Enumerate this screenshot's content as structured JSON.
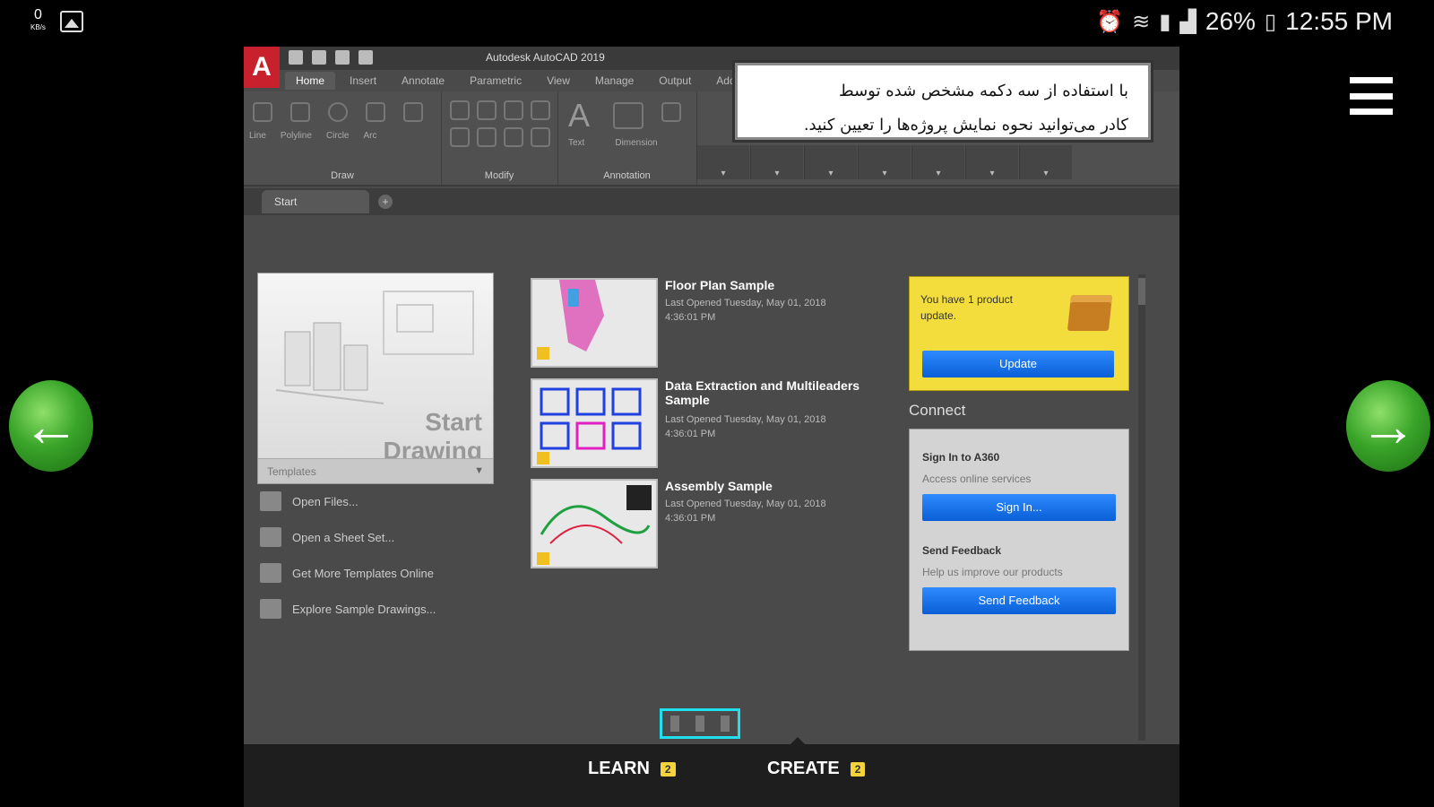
{
  "status_bar": {
    "net_speed_value": "0",
    "net_speed_unit": "KB/s",
    "battery": "26%",
    "time": "12:55 PM",
    "icons": [
      "gallery-icon",
      "alarm-icon",
      "wifi-icon",
      "sim-icon",
      "signal-icon",
      "battery-icon"
    ]
  },
  "autocad": {
    "title": "Autodesk AutoCAD 2019",
    "logo": "A",
    "tabs": [
      "Home",
      "Insert",
      "Annotate",
      "Parametric",
      "View",
      "Manage",
      "Output",
      "Add-ins"
    ],
    "ribbon_groups": [
      "Draw",
      "Modify",
      "Annotation"
    ],
    "draw_tools": [
      "Line",
      "Polyline",
      "Circle",
      "Arc"
    ],
    "annotation_tools": [
      "Text",
      "Dimension"
    ],
    "doc_tab": "Start",
    "doc_tab_add": "+"
  },
  "tooltip": {
    "line1": "با استفاده از سه دکمه مشخص شده توسط",
    "line2": "کادر می‌توانید نحوه نمایش پروژه‌ها را تعیین کنید."
  },
  "start_page": {
    "start_drawing": "Start Drawing",
    "templates_label": "Templates",
    "links": [
      "Open Files...",
      "Open a Sheet Set...",
      "Get More Templates Online",
      "Explore Sample Drawings..."
    ],
    "recent": [
      {
        "title": "Floor Plan Sample",
        "sub1": "Last Opened Tuesday, May 01, 2018",
        "sub2": "4:36:01 PM"
      },
      {
        "title": "Data Extraction and Multileaders Sample",
        "sub1": "Last Opened Tuesday, May 01, 2018",
        "sub2": "4:36:01 PM"
      },
      {
        "title": "Assembly Sample",
        "sub1": "Last Opened Tuesday, May 01, 2018",
        "sub2": "4:36:01 PM"
      }
    ],
    "update": {
      "message": "You have 1 product update.",
      "button": "Update"
    },
    "connect": {
      "label": "Connect",
      "signin_title": "Sign In to A360",
      "signin_sub": "Access online services",
      "signin_button": "Sign In...",
      "feedback_title": "Send Feedback",
      "feedback_sub": "Help us improve our products",
      "feedback_button": "Send Feedback"
    }
  },
  "bottom": {
    "learn": "LEARN",
    "learn_badge": "2",
    "create": "CREATE",
    "create_badge": "2"
  },
  "colors": {
    "highlight": "#20e0f0",
    "nav_green": "#3aa52a",
    "update_yellow": "#f3dd3c",
    "button_blue": "#0a5fd6"
  }
}
